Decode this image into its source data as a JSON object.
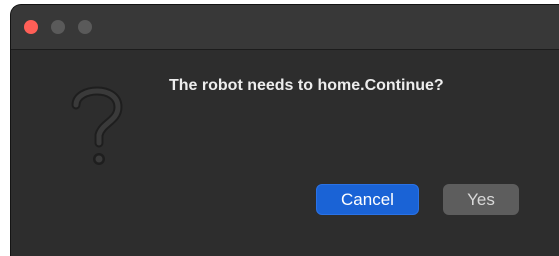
{
  "dialog": {
    "message": "The robot needs to home.Continue?",
    "icon": "question-mark-icon",
    "buttons": {
      "cancel_label": "Cancel",
      "yes_label": "Yes"
    }
  },
  "window_controls": [
    "close",
    "minimize",
    "zoom"
  ],
  "colors": {
    "window_bg": "#2d2d2d",
    "titlebar_bg": "#383838",
    "close": "#ff5f57",
    "inactive_control": "#5a5a5a",
    "primary_button": "#1a63d6",
    "secondary_button": "#5d5d5d",
    "text": "#ededed"
  }
}
